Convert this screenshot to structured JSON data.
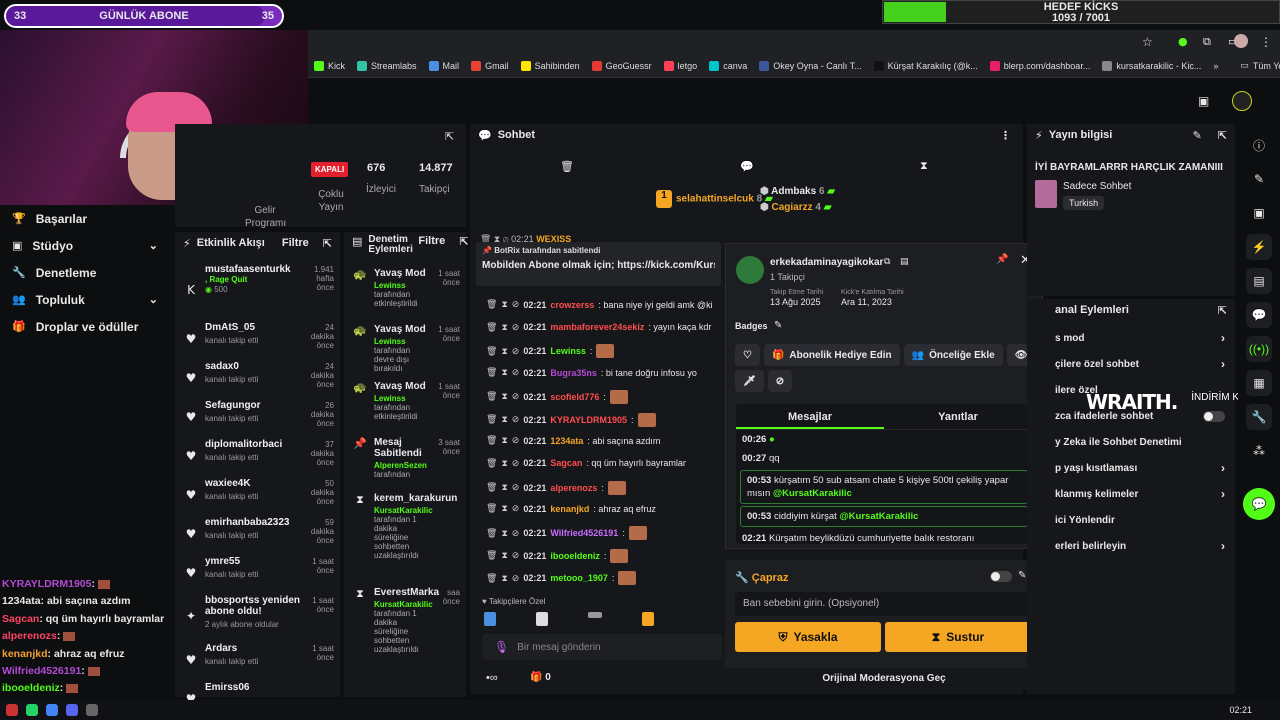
{
  "overlay": {
    "sub_goal": {
      "left": "33",
      "label": "GÜNLÜK ABONE",
      "right": "35",
      "progress": 0.94
    },
    "kick_goal": {
      "label": "HEDEF KİCKS",
      "value": "1093 / 7001",
      "progress": 0.156
    },
    "sponsor": {
      "brand": "WRAITH.",
      "promo": "İNDİRİM KODU: \"QQ\""
    },
    "chat": [
      {
        "name": "KYRAYLDRM1905",
        "text": ":",
        "color": "#b34ad6",
        "emote": true
      },
      {
        "name": "1234ata",
        "text": ": abi saçına azdım",
        "color": "#e8e8e8",
        "emote": false
      },
      {
        "name": "Sagcan",
        "text": ": qq üm hayırlı bayramlar",
        "color": "#ff4466",
        "emote": false
      },
      {
        "name": "alperenozs",
        "text": ":",
        "color": "#ff4466",
        "emote": true
      },
      {
        "name": "kenanjkd",
        "text": ": ahraz aq efruz",
        "color": "#f0a030",
        "emote": false
      },
      {
        "name": "Wilfried4526191",
        "text": ":",
        "color": "#b34ad6",
        "emote": true
      },
      {
        "name": "ibooeldeniz",
        "text": ":",
        "color": "#53fc18",
        "emote": true
      },
      {
        "name": "metooo_1907",
        "text": ":",
        "color": "#53fc18",
        "emote": true
      }
    ]
  },
  "bookmarks": [
    {
      "label": "Kick",
      "color": "#53fc18"
    },
    {
      "label": "Streamlabs",
      "color": "#31c3a2"
    },
    {
      "label": "Mail",
      "color": "#4a90e2"
    },
    {
      "label": "Gmail",
      "color": "#ea4335"
    },
    {
      "label": "Sahibinden",
      "color": "#ffe800"
    },
    {
      "label": "GeoGuessr",
      "color": "#e53935"
    },
    {
      "label": "letgo",
      "color": "#ff3f55"
    },
    {
      "label": "canva",
      "color": "#00c4cc"
    },
    {
      "label": "Okey Oyna - Canlı T...",
      "color": "#3b5998"
    },
    {
      "label": "Kürşat Karakılıç (@k...",
      "color": "#111111"
    },
    {
      "label": "blerp.com/dashboar...",
      "color": "#e91e63"
    },
    {
      "label": "kursatkarakilic - Kic...",
      "color": "#888888"
    }
  ],
  "bookmarks_more": "»",
  "bookmarks_all": "Tüm Yer İşaretleri",
  "left_menu": [
    {
      "label": "Başarılar",
      "icon": "trophy-icon",
      "glyph": "🏆",
      "chevron": false
    },
    {
      "label": "Stüdyo",
      "icon": "studio-icon",
      "glyph": "▣",
      "chevron": true
    },
    {
      "label": "Denetleme",
      "icon": "wrench-icon",
      "glyph": "🔧",
      "chevron": false
    },
    {
      "label": "Topluluk",
      "icon": "users-icon",
      "glyph": "👥",
      "chevron": true
    },
    {
      "label": "Droplar ve ödüller",
      "icon": "gift-icon",
      "glyph": "🎁",
      "chevron": false
    }
  ],
  "stats": {
    "badge": "KAPALI",
    "viewers": {
      "value": "676",
      "label": "İzleyici"
    },
    "followers": {
      "value": "14.877",
      "label": "Takipçi"
    },
    "status_label": "Çoklu Yayın",
    "program_label": "Gelir Programı"
  },
  "activity": {
    "title": "Etkinlik Akışı",
    "filter": "Filtre",
    "items": [
      {
        "icon": "kick-icon",
        "glyph": "K",
        "name": "mustafaasenturkk",
        "extra": ", Rage Quit",
        "sub": "500",
        "time": "1.941 hafta önce"
      },
      {
        "icon": "heart-icon",
        "glyph": "♥",
        "name": "DmAtS_05",
        "sub": "kanalı takip etti",
        "time": "24 dakika önce"
      },
      {
        "icon": "heart-icon",
        "glyph": "♥",
        "name": "sadax0",
        "sub": "kanalı takip etti",
        "time": "24 dakika önce"
      },
      {
        "icon": "heart-icon",
        "glyph": "♥",
        "name": "Sefagungor",
        "sub": "kanalı takip etti",
        "time": "26 dakika önce"
      },
      {
        "icon": "heart-icon",
        "glyph": "♥",
        "name": "diplomalitorbaci",
        "sub": "kanalı takip etti",
        "time": "37 dakika önce"
      },
      {
        "icon": "heart-icon",
        "glyph": "♥",
        "name": "waxiee4K",
        "sub": "kanalı takip etti",
        "time": "50 dakika önce"
      },
      {
        "icon": "heart-icon",
        "glyph": "♥",
        "name": "emirhanbaba2323",
        "sub": "kanalı takip etti",
        "time": "59 dakika önce"
      },
      {
        "icon": "heart-icon",
        "glyph": "♥",
        "name": "ymre55",
        "sub": "kanalı takip etti",
        "time": "1 saat önce"
      },
      {
        "icon": "star-icon",
        "glyph": "✦",
        "name": "bbosportss yeniden abone oldu!",
        "sub": "2 aylık abone oldular",
        "time": "1 saat önce"
      },
      {
        "icon": "heart-icon",
        "glyph": "♥",
        "name": "Ardars",
        "sub": "kanalı takip etti",
        "time": "1 saat önce"
      },
      {
        "icon": "heart-icon",
        "glyph": "♥",
        "name": "Emirss06",
        "sub": "",
        "time": ""
      }
    ]
  },
  "modactions": {
    "title": "Denetim Eylemleri",
    "filter": "Filtre",
    "items": [
      {
        "glyph": "🐢",
        "name": "Yavaş Mod",
        "by": "Lewinss",
        "sub": "tarafından etkinleştirildi",
        "time": "1 saat önce"
      },
      {
        "glyph": "🐢",
        "name": "Yavaş Mod",
        "by": "Lewinss",
        "sub": "tarafından devre dışı bırakıldı",
        "time": "1 saat önce"
      },
      {
        "glyph": "🐢",
        "name": "Yavaş Mod",
        "by": "Lewinss",
        "sub": "tarafından etkinleştirildi",
        "time": "1 saat önce"
      },
      {
        "glyph": "📌",
        "name": "Mesaj Sabitlendi",
        "by": "AlperenSezen",
        "sub": "tarafından",
        "time": "3 saat önce"
      },
      {
        "glyph": "⧗",
        "name": "kerem_karakurun",
        "by": "KursatKarakilic",
        "sub": "tarafından 1 dakika süreliğine sohbetten uzaklaştırıldı",
        "time": ""
      },
      {
        "glyph": "⧗",
        "name": "EverestMarka",
        "by": "KursatKarakilic",
        "sub": "tarafından 1 dakika süreliğine sohbetten uzaklaştırıldı",
        "time": "saa önce"
      }
    ]
  },
  "chat": {
    "title": "Sohbet",
    "top_users": [
      {
        "name": "selahattinselcuk",
        "count": "8",
        "color": "#f5a623"
      },
      {
        "name": "Admbaks",
        "count": "6",
        "color": "#e8e8e8"
      },
      {
        "name": "Cagiarzz",
        "count": "4",
        "color": "#f5a623"
      }
    ],
    "pinned_by": "BotRix tarafından sabitlendi",
    "pinned_text": "Mobilden Abone olmak için; https://kick.com/Kursa",
    "messages": [
      {
        "time": "02:21",
        "user": "crowzerss",
        "text": ": bana niye iyi geldi amk @ki",
        "color": "#ff4d4d"
      },
      {
        "time": "02:21",
        "user": "mambaforever24sekiz",
        "text": ": yayın kaça kdr",
        "color": "#ff4d4d"
      },
      {
        "time": "02:21",
        "user": "Lewinss",
        "text": ":",
        "color": "#53fc18"
      },
      {
        "time": "02:21",
        "user": "Bugra35ns",
        "text": ": bi tane doğru infosu yo",
        "color": "#b34ad6"
      },
      {
        "time": "02:21",
        "user": "scofield776",
        "text": ":",
        "color": "#ff4d4d"
      },
      {
        "time": "02:21",
        "user": "KYRAYLDRM1905",
        "text": ":",
        "color": "#ff4d4d"
      },
      {
        "time": "02:21",
        "user": "1234ata",
        "text": ": abi saçına azdım",
        "color": "#f5a623"
      },
      {
        "time": "02:21",
        "user": "Sagcan",
        "text": ": qq üm hayırlı bayramlar",
        "color": "#ff4d4d"
      },
      {
        "time": "02:21",
        "user": "alperenozs",
        "text": ":",
        "color": "#ff4d4d"
      },
      {
        "time": "02:21",
        "user": "kenanjkd",
        "text": ": ahraz aq efruz",
        "color": "#f5a623"
      },
      {
        "time": "02:21",
        "user": "Wilfried4526191",
        "text": ":",
        "color": "#c86bff"
      },
      {
        "time": "02:21",
        "user": "ibooeldeniz",
        "text": ":",
        "color": "#53fc18"
      },
      {
        "time": "02:21",
        "user": "metooo_1907",
        "text": ":",
        "color": "#53fc18"
      }
    ],
    "partial_top": {
      "time": "02:21",
      "user": "WEXISS"
    },
    "emote_bar_label": "Takipçilere Özel",
    "input_placeholder": "Bir mesaj gönderin",
    "bottom_count": "0"
  },
  "user_popup": {
    "username": "erkekadaminayagikokar",
    "followers": "1 Takipçi",
    "follow_date_label": "Takip Etme Tarihi",
    "follow_date": "13 Ağu 2025",
    "join_label": "Kick'e Katılma Tarihi",
    "join_date": "Ara 11, 2023",
    "badges_label": "Badges",
    "gift_btn": "Abonelik Hediye Edin",
    "vip_btn": "Önceliğe Ekle",
    "tabs": [
      "Mesajlar",
      "Yanıtlar"
    ],
    "history": [
      {
        "time": "00:26",
        "text": ""
      },
      {
        "time": "00:27",
        "text": "qq"
      },
      {
        "time": "00:53",
        "text": "kürşatım 50 sub atsam chate 5 kişiye 500tl çekiliş yapar mısın ",
        "mention": "@KursatKarakilic"
      },
      {
        "time": "00:53",
        "text": "ciddiyim kürşat ",
        "mention": "@KursatKarakilic"
      },
      {
        "time": "02:21",
        "text": "Kürşatım beylikdüzü cumhuriyette balık restoranı"
      }
    ]
  },
  "ban": {
    "title": "Çapraz",
    "placeholder": "Ban sebebini girin. (Opsiyonel)",
    "ban_btn": "Yasakla",
    "timeout_btn": "Sustur",
    "orig_mod": "Orijinal Moderasyona Geç"
  },
  "stream_info": {
    "title": "Yayın bilgisi",
    "stream_title": "İYİ BAYRAMLARRR HARÇLIK ZAMANIII",
    "category": "Sadece Sohbet",
    "language": "Turkish"
  },
  "channel_actions": {
    "title": "anal Eylemleri",
    "rows": [
      {
        "label": "s mod",
        "chevron": true,
        "toggle": false
      },
      {
        "label": "çilere özel sohbet",
        "chevron": true,
        "toggle": false
      },
      {
        "label": "ilere özel",
        "chevron": false,
        "toggle": false
      },
      {
        "label": "zca ifadelerle sohbet",
        "chevron": false,
        "toggle": true
      },
      {
        "label": "y Zeka ile Sohbet Denetimi",
        "chevron": false,
        "toggle": false
      },
      {
        "label": "p yaşı kısıtlaması",
        "chevron": true,
        "toggle": false
      },
      {
        "label": "klanmış kelimeler",
        "chevron": true,
        "toggle": false
      },
      {
        "label": "ici Yönlendir",
        "chevron": false,
        "toggle": false
      },
      {
        "label": "erleri belirleyin",
        "chevron": true,
        "toggle": false
      }
    ]
  },
  "taskbar_time": "02:21",
  "colors": {
    "kick_green": "#53fc18",
    "accent_yellow": "#f5a623",
    "panel": "#16171a"
  }
}
